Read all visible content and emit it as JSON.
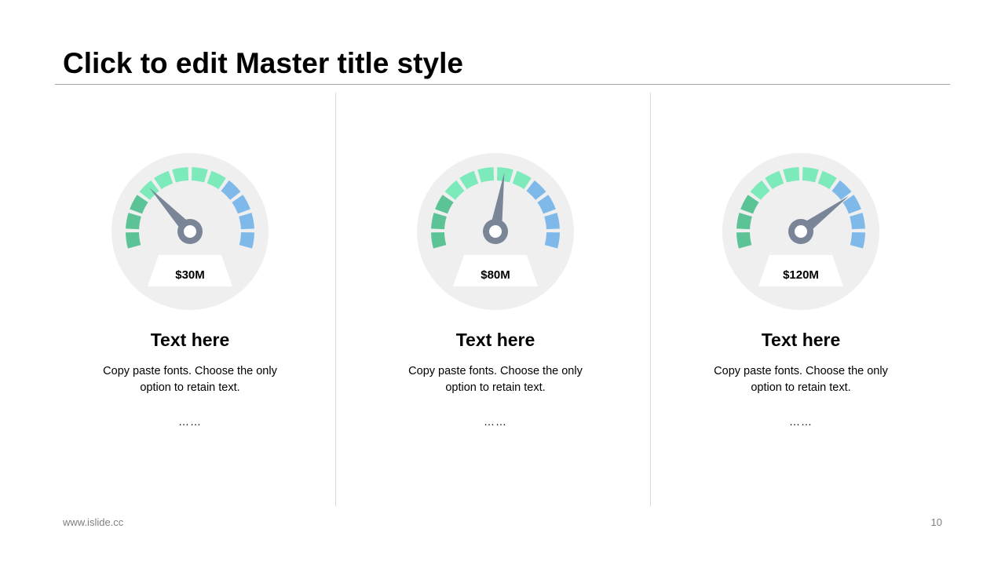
{
  "title": "Click to edit Master title style",
  "colors": {
    "bezel": "#efefef",
    "arc_dark_green": "#5cc396",
    "arc_light_green": "#7deabb",
    "arc_blue": "#7eb9ea",
    "needle": "#7a8597",
    "label_box": "#ffffff"
  },
  "cards": [
    {
      "value_label": "$30M",
      "needle_level": 0.3,
      "heading": "Text here",
      "body": "Copy paste fonts. Choose the only option to retain text.",
      "more": "……"
    },
    {
      "value_label": "$80M",
      "needle_level": 0.54,
      "heading": "Text here",
      "body": "Copy paste fonts. Choose the only option to retain text.",
      "more": "……"
    },
    {
      "value_label": "$120M",
      "needle_level": 0.75,
      "heading": "Text here",
      "body": "Copy paste fonts. Choose the only option to retain text.",
      "more": "……"
    }
  ],
  "footer": {
    "website": "www.islide.cc",
    "page_number": "10"
  }
}
